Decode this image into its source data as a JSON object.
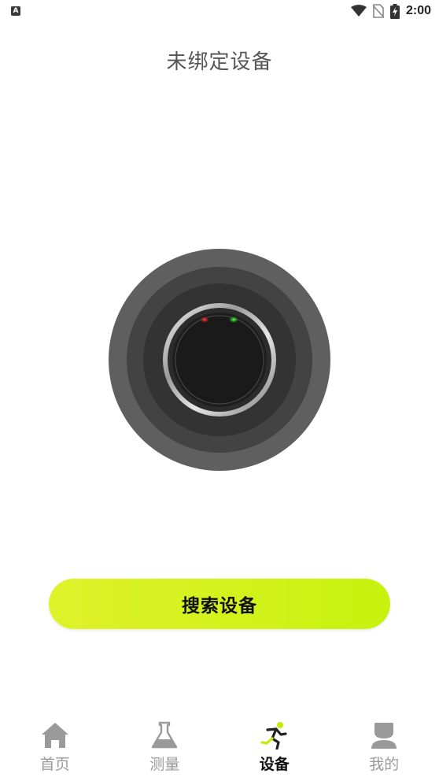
{
  "status_bar": {
    "left_icon": "notification-a-icon",
    "left_icon_letter": "A",
    "icons": [
      "wifi-icon",
      "no-sim-icon",
      "battery-charging-icon"
    ],
    "time": "2:00"
  },
  "page": {
    "title": "未绑定设备"
  },
  "device": {
    "image": "smart-ring-icon"
  },
  "actions": {
    "search_label": "搜索设备"
  },
  "tabs": [
    {
      "label": "首页",
      "icon": "home-icon",
      "active": false
    },
    {
      "label": "测量",
      "icon": "flask-icon",
      "active": false
    },
    {
      "label": "设备",
      "icon": "running-person-icon",
      "active": true
    },
    {
      "label": "我的",
      "icon": "user-icon",
      "active": false
    }
  ],
  "colors": {
    "accent": "#d4f21a",
    "inactive_tab": "#9a9a9a",
    "active_tab": "#111111"
  }
}
